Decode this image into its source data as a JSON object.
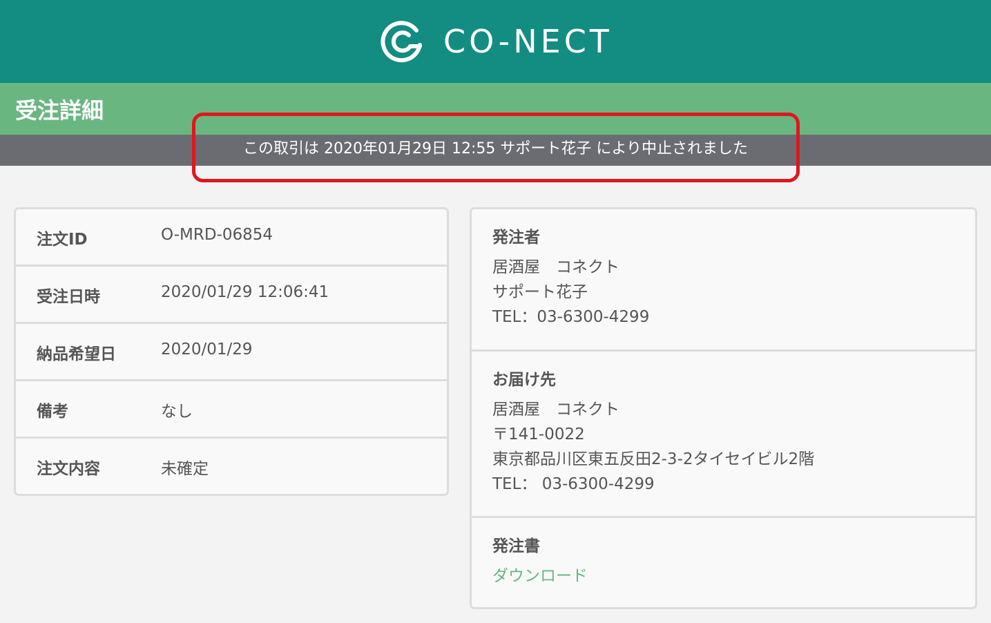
{
  "header": {
    "brand": "CO-NECT"
  },
  "page": {
    "title": "受注詳細"
  },
  "notice": {
    "text": "この取引は 2020年01月29日 12:55 サポート花子 により中止されました",
    "highlight_color": "#e0161e"
  },
  "order_info": {
    "rows": [
      {
        "label": "注文ID",
        "value": "O-MRD-06854"
      },
      {
        "label": "受注日時",
        "value": "2020/01/29 12:06:41"
      },
      {
        "label": "納品希望日",
        "value": "2020/01/29"
      },
      {
        "label": "備考",
        "value": "なし"
      },
      {
        "label": "注文内容",
        "value": "未確定"
      }
    ]
  },
  "orderer": {
    "title": "発注者",
    "lines": [
      "居酒屋　コネクト",
      "サポート花子",
      "TEL：03-6300-4299"
    ]
  },
  "delivery": {
    "title": "お届け先",
    "lines": [
      "居酒屋　コネクト",
      "〒141-0022",
      "東京都品川区東五反田2-3-2タイセイビル2階",
      "TEL： 03-6300-4299"
    ]
  },
  "purchase_order": {
    "title": "発注書",
    "link_label": "ダウンロード"
  },
  "colors": {
    "header": "#138d82",
    "title_bar": "#6ab681",
    "notice_bar": "#6b6c72",
    "link": "#6ab681"
  }
}
